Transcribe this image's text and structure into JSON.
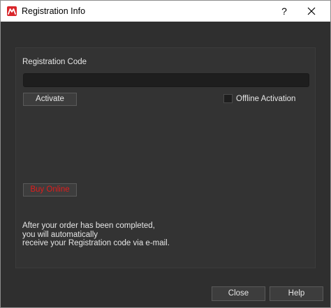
{
  "window": {
    "title": "Registration Info",
    "help_glyph": "?",
    "app_icon": "app-logo-icon",
    "close_icon": "close-icon"
  },
  "form": {
    "registration_label": "Registration Code",
    "registration_value": "",
    "activate_label": "Activate",
    "offline_label": "Offline Activation",
    "offline_checked": false,
    "buy_label": "Buy Online",
    "info_lines": [
      "After your order has been completed,",
      "you will automatically",
      "receive your Registration code via e-mail."
    ]
  },
  "footer": {
    "close_label": "Close",
    "help_label": "Help"
  },
  "colors": {
    "background": "#2f2f2f",
    "panel": "#333333",
    "input": "#1e1e1e",
    "text": "#e6e6e6",
    "buy_text": "#e11c1c",
    "brand": "#d9262b"
  }
}
